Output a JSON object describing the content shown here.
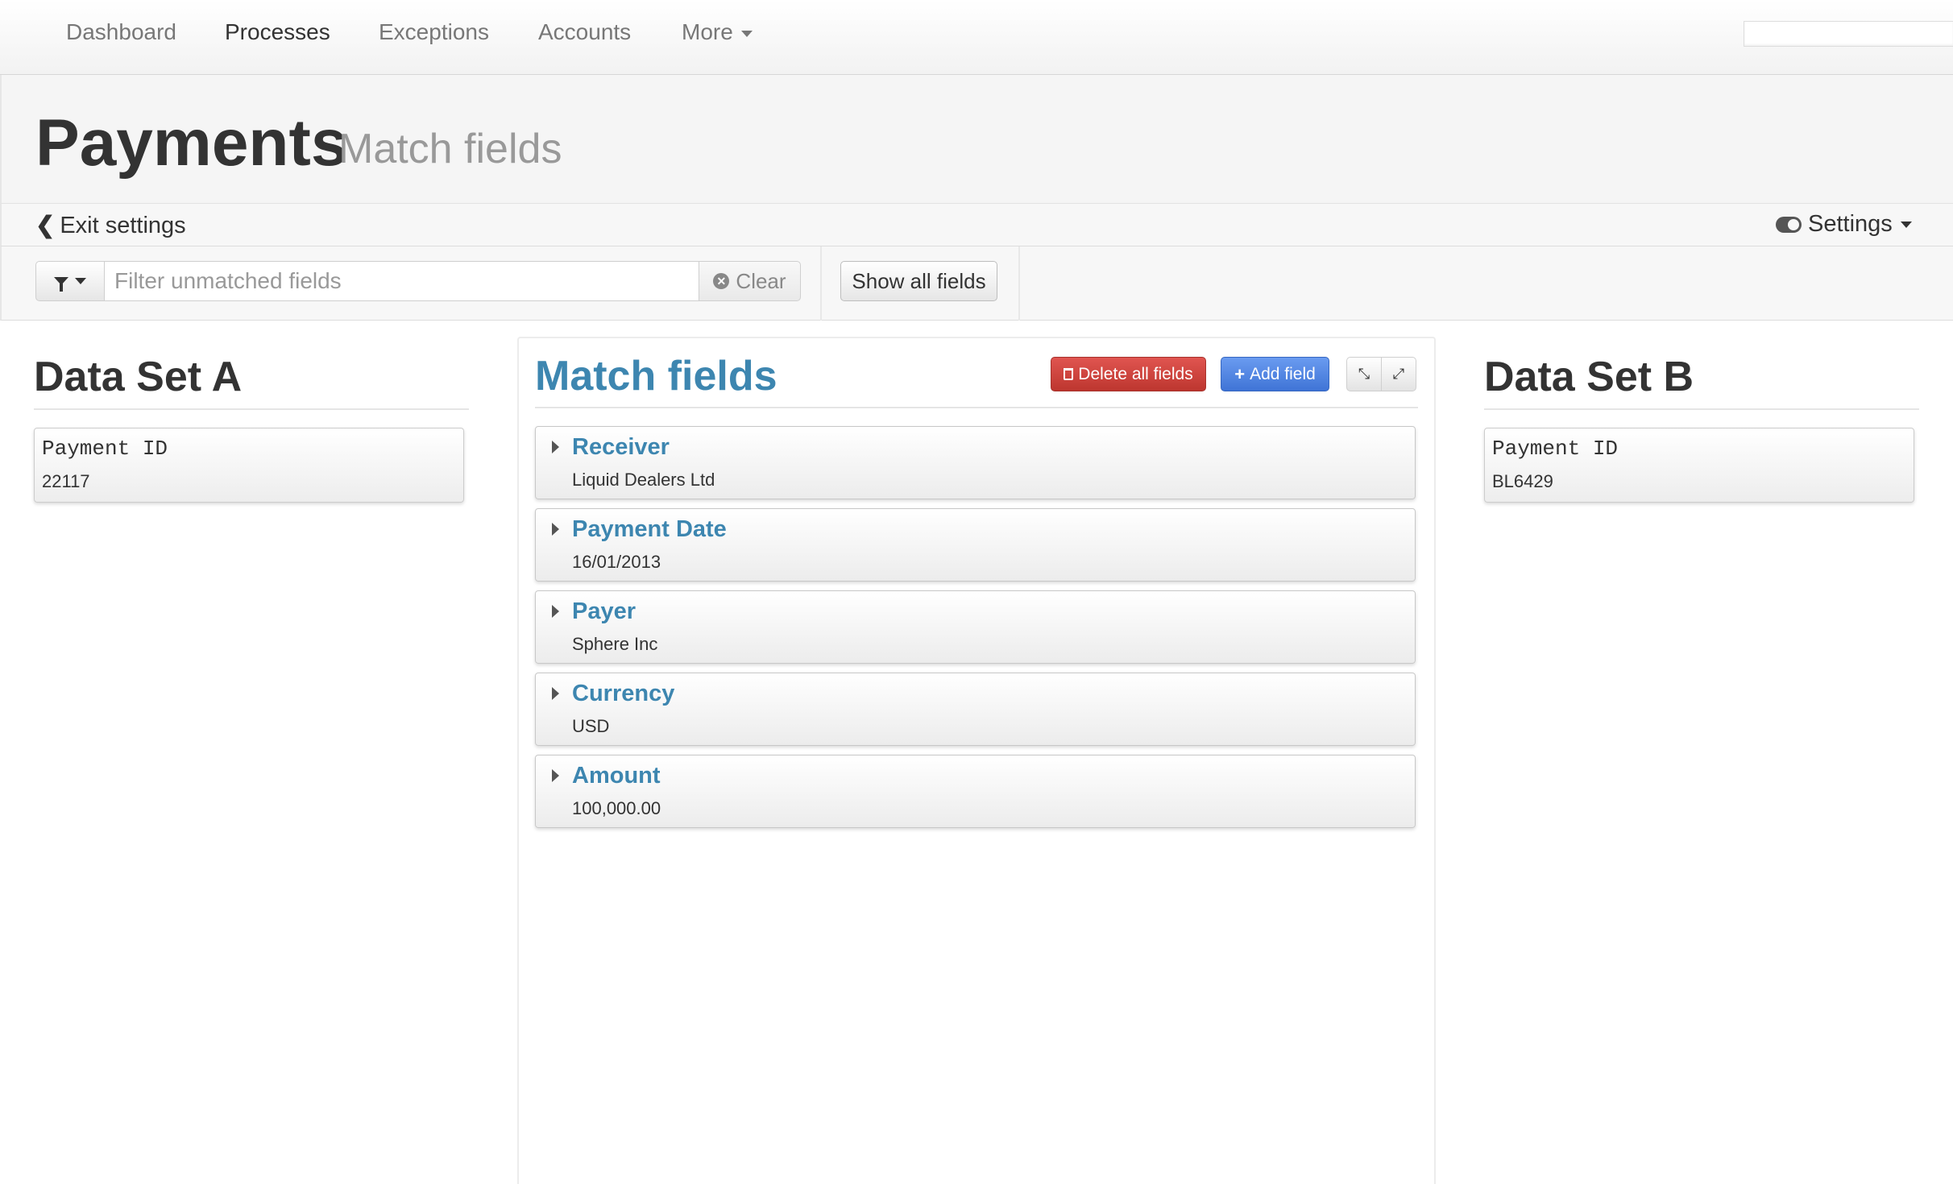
{
  "nav": {
    "items": [
      {
        "label": "Dashboard",
        "active": false
      },
      {
        "label": "Processes",
        "active": true
      },
      {
        "label": "Exceptions",
        "active": false
      },
      {
        "label": "Accounts",
        "active": false
      },
      {
        "label": "More",
        "active": false,
        "has_caret": true
      }
    ]
  },
  "header": {
    "title": "Payments",
    "subtitle": "Match fields"
  },
  "settings_bar": {
    "exit_label": "Exit settings",
    "settings_label": "Settings"
  },
  "filter": {
    "placeholder": "Filter unmatched fields",
    "value": "",
    "clear_label": "Clear",
    "show_all_label": "Show all fields"
  },
  "data_set_a": {
    "title": "Data Set A",
    "fields": [
      {
        "label": "Payment ID",
        "value": "22117"
      }
    ]
  },
  "match_fields": {
    "title": "Match fields",
    "delete_all_label": "Delete all fields",
    "add_field_label": "Add field",
    "fields": [
      {
        "name": "Receiver",
        "value": "Liquid Dealers Ltd"
      },
      {
        "name": "Payment Date",
        "value": "16/01/2013"
      },
      {
        "name": "Payer",
        "value": "Sphere Inc"
      },
      {
        "name": "Currency",
        "value": "USD"
      },
      {
        "name": "Amount",
        "value": "100,000.00"
      }
    ]
  },
  "data_set_b": {
    "title": "Data Set B",
    "fields": [
      {
        "label": "Payment ID",
        "value": "BL6429"
      }
    ]
  },
  "colors": {
    "accent": "#3d86b0",
    "danger": "#bd362f",
    "primary": "#3f74d6"
  }
}
